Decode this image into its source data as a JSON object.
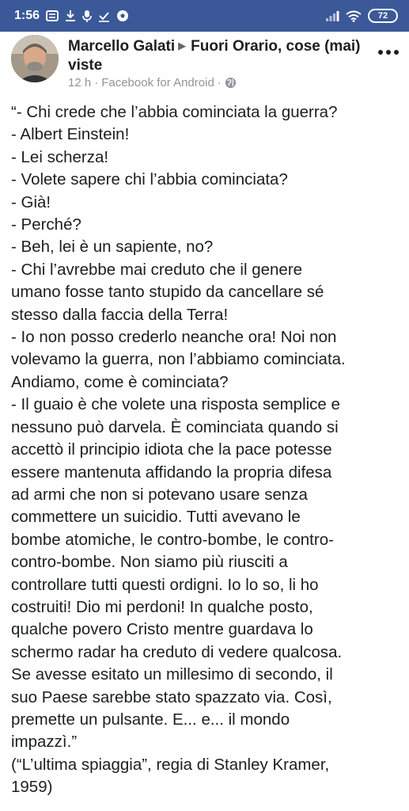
{
  "status_bar": {
    "time": "1:56",
    "battery": "72",
    "icons_left": [
      "notification-icon",
      "download-icon",
      "microphone-icon",
      "check-icon",
      "soccer-ball-icon"
    ],
    "icons_right": [
      "signal-icon",
      "wifi-icon",
      "battery-icon"
    ]
  },
  "post": {
    "author": "Marcello Galati",
    "group": "Fuori Orario, cose (mai) viste",
    "time": "12 h",
    "source": "Facebook for Android",
    "separator": "·",
    "privacy_icon": "globe-icon",
    "body_lines": [
      "“- Chi crede che l’abbia cominciata la guerra?",
      "- Albert Einstein!",
      "- Lei scherza!",
      "- Volete sapere chi l’abbia cominciata?",
      "- Già!",
      "- Perché?",
      "- Beh, lei è un sapiente, no?",
      "- Chi l’avrebbe mai creduto che il genere",
      "umano fosse tanto stupido da cancellare sé",
      "stesso dalla faccia della Terra!",
      "- Io non posso crederlo neanche ora! Noi non",
      "volevamo la guerra, non l’abbiamo cominciata.",
      "Andiamo, come è cominciata?",
      "- Il guaio è che volete una risposta semplice e",
      "nessuno può darvela. È cominciata quando si",
      "accettò il principio idiota che la pace potesse",
      "essere mantenuta affidando la propria difesa",
      "ad armi che non si potevano usare senza",
      "commettere un suicidio. Tutti avevano le",
      "bombe atomiche, le contro-bombe, le contro-",
      "contro-bombe. Non siamo più riusciti a",
      "controllare tutti questi ordigni. Io lo so, li ho",
      "costruiti! Dio mi perdoni! In qualche posto,",
      "qualche povero Cristo mentre guardava lo",
      "schermo radar ha creduto di vedere qualcosa.",
      "Se avesse esitato un millesimo di secondo, il",
      "suo Paese sarebbe stato spazzato via. Così,",
      "premette un pulsante. E... e... il mondo",
      "impazzì.”",
      "(“L’ultima spiaggia”, regia di Stanley Kramer,",
      "1959)"
    ]
  }
}
